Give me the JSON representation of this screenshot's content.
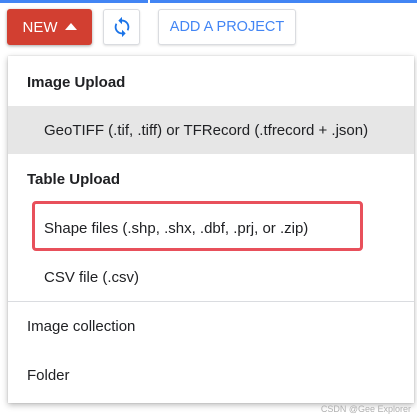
{
  "toolbar": {
    "new_label": "NEW",
    "add_project_label": "ADD A PROJECT"
  },
  "menu": {
    "image_upload_heading": "Image Upload",
    "image_upload_item": "GeoTIFF (.tif, .tiff) or TFRecord (.tfrecord + .json)",
    "table_upload_heading": "Table Upload",
    "shape_files_item": "Shape files (.shp, .shx, .dbf, .prj, or .zip)",
    "csv_item": "CSV file (.csv)",
    "image_collection_item": "Image collection",
    "folder_item": "Folder"
  },
  "watermark": "CSDN @Gee Explorer",
  "colors": {
    "new_button": "#d23f31",
    "accent_blue": "#4285f4",
    "highlight_annotation": "#e8505b",
    "selected_item_bg": "#e6e6e6"
  }
}
